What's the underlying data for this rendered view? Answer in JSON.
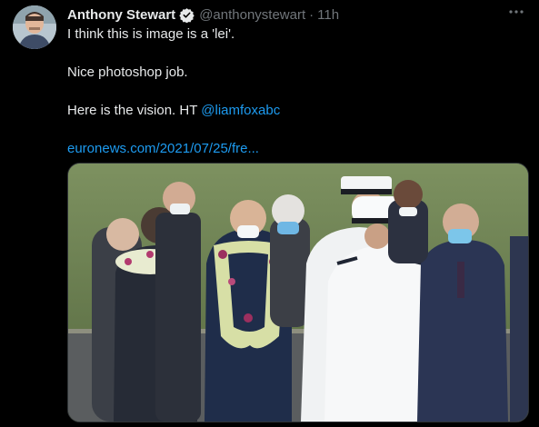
{
  "tweet": {
    "author_name": "Anthony Stewart",
    "handle": "@anthonystewart",
    "separator": "·",
    "time": "11h",
    "lines": [
      "I think this is image is a 'lei'.",
      "",
      "Nice photoshop job.",
      "",
      "Here is the vision.  HT "
    ],
    "mention": "@liamfoxabc",
    "url": "euronews.com/2021/07/25/fre...",
    "more_icon": "more-horizontal-icon",
    "verified_icon": "verified-badge-icon"
  },
  "colors": {
    "background": "#000000",
    "text": "#e7e9ea",
    "muted": "#71767b",
    "link": "#1d9bf0"
  }
}
